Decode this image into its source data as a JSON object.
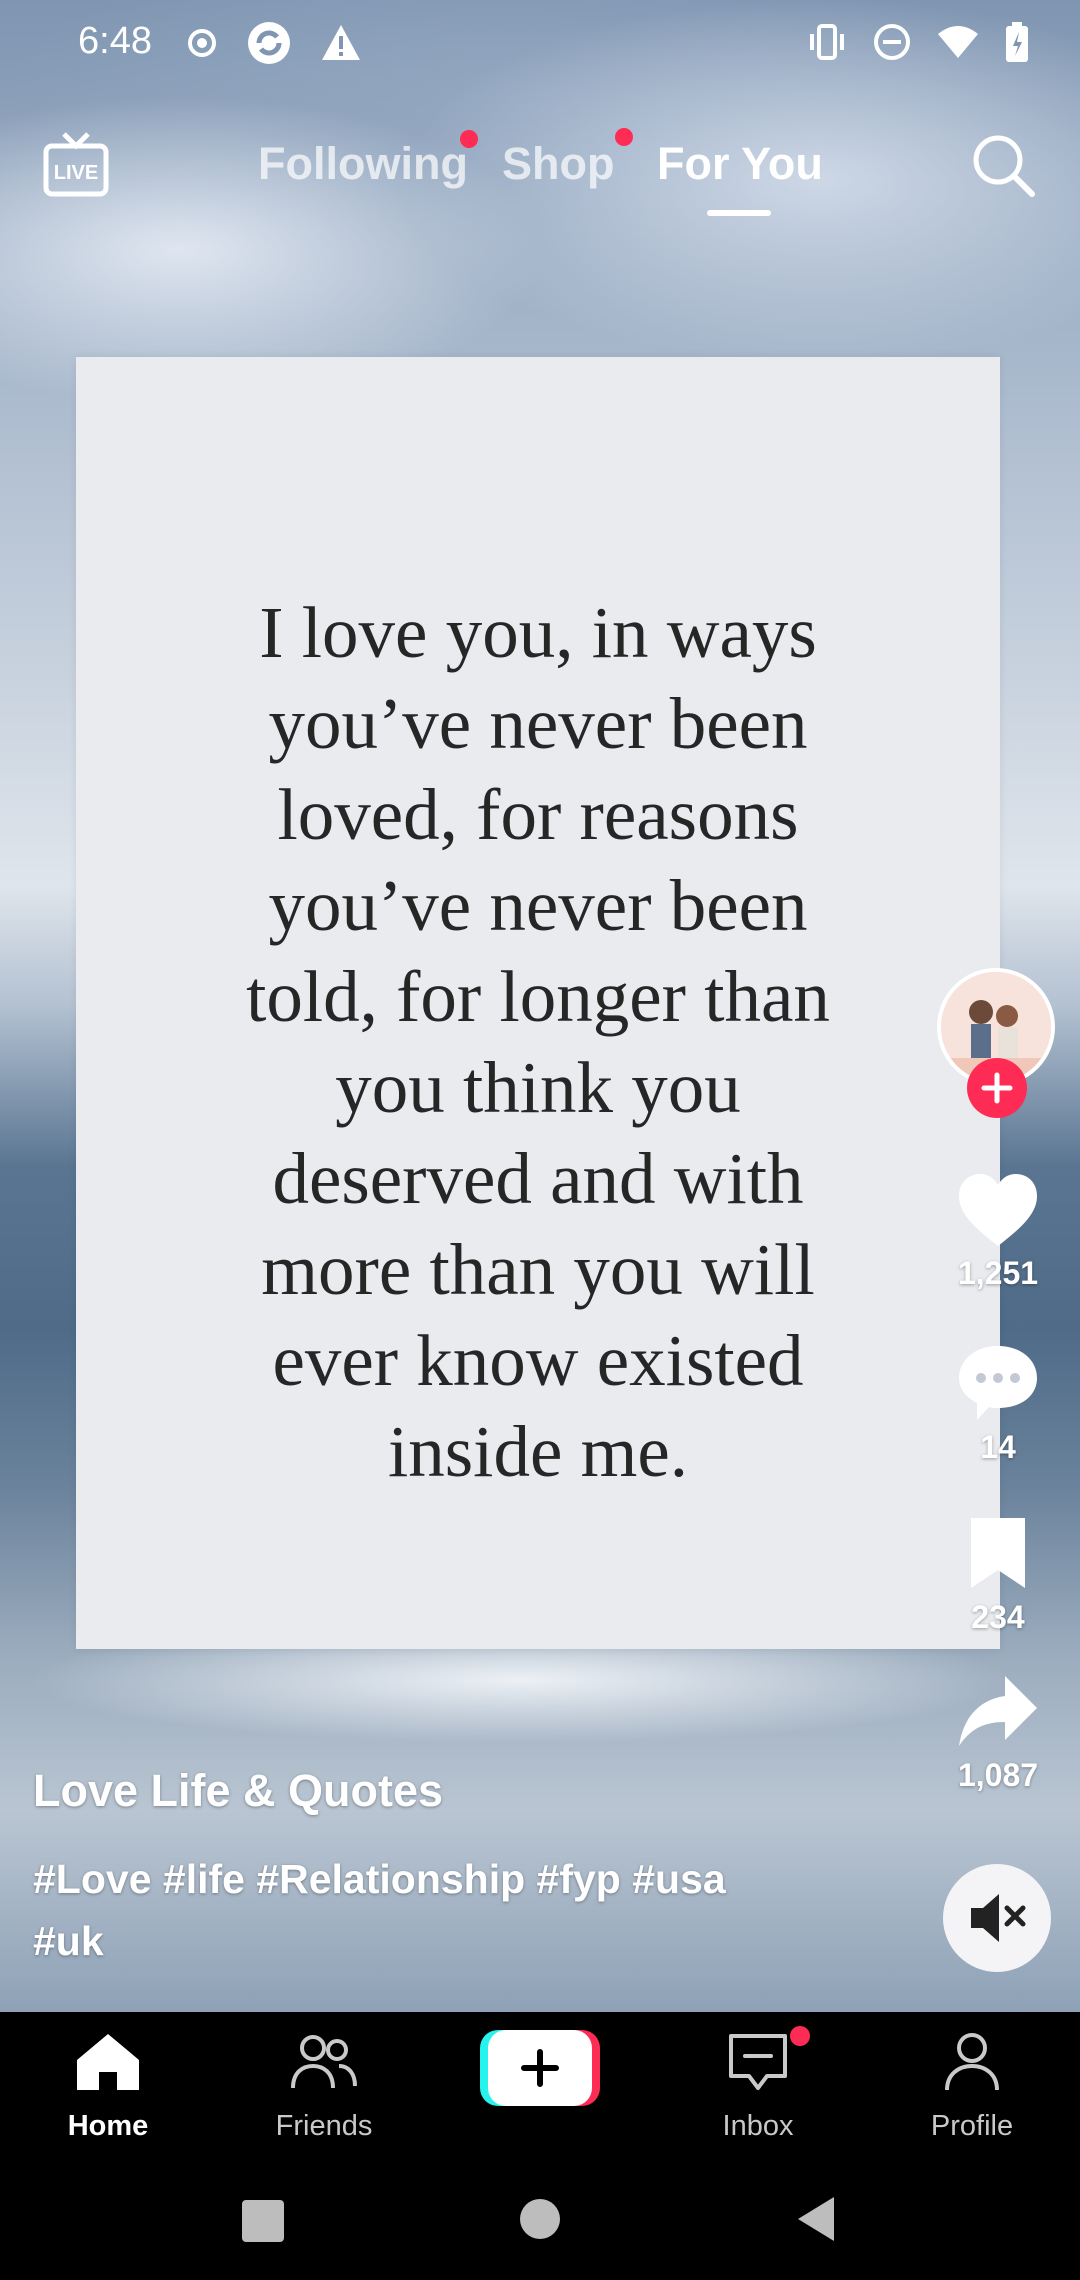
{
  "status_bar": {
    "time": "6:48",
    "left_icons": [
      "record-icon",
      "sync-icon",
      "warning-icon"
    ],
    "right_icons": [
      "vibrate-icon",
      "do-not-disturb-icon",
      "wifi-icon",
      "battery-icon"
    ]
  },
  "top_nav": {
    "live_icon": "live-icon",
    "tabs": [
      {
        "label": "Following",
        "has_dot": true,
        "active": false
      },
      {
        "label": "Shop",
        "has_dot": true,
        "active": false
      },
      {
        "label": "For You",
        "has_dot": false,
        "active": true
      }
    ],
    "search_icon": "search-icon"
  },
  "video": {
    "quote_text": "I love you, in ways\nyou’ve never been\nloved, for reasons\nyou’ve never been\ntold, for longer than\nyou think you\ndeserved and with\nmore than you will\never know existed\ninside me."
  },
  "actions": {
    "likes": "1,251",
    "comments": "14",
    "saves": "234",
    "shares": "1,087"
  },
  "caption": {
    "author": "Love Life & Quotes",
    "hashtags": "#Love #life #Relationship #fyp #usa\n#uk"
  },
  "bottom_nav": {
    "items": [
      {
        "label": "Home",
        "icon": "home-icon",
        "active": true
      },
      {
        "label": "Friends",
        "icon": "friends-icon",
        "active": false
      },
      {
        "label": "",
        "icon": "create-plus-icon",
        "active": false
      },
      {
        "label": "Inbox",
        "icon": "inbox-icon",
        "active": false
      },
      {
        "label": "Profile",
        "icon": "profile-icon",
        "active": false
      }
    ]
  },
  "colors": {
    "accent_red": "#fe2c55",
    "create_cyan": "#25f4ee",
    "nav_background": "#000000"
  }
}
